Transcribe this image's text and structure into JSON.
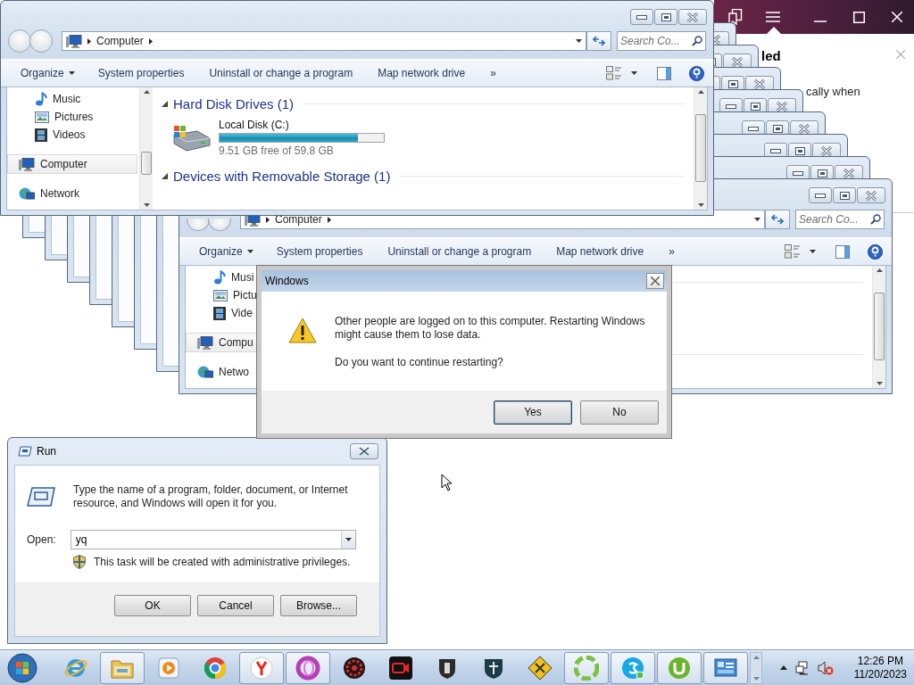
{
  "browser": {
    "heading": "led",
    "text": "cally when"
  },
  "explorer_front": {
    "address": "Computer",
    "search": {
      "placeholder": "Search Co..."
    },
    "commands": [
      {
        "label": "Organize",
        "kind": "menu"
      },
      {
        "label": "System properties",
        "kind": "plain"
      },
      {
        "label": "Uninstall or change a program",
        "kind": "plain"
      },
      {
        "label": "Map network drive",
        "kind": "plain"
      },
      {
        "label": "»",
        "kind": "more"
      }
    ],
    "nav": [
      {
        "label": "Music",
        "kind": "music",
        "selected": false
      },
      {
        "label": "Pictures",
        "kind": "pictures",
        "selected": false
      },
      {
        "label": "Videos",
        "kind": "videos",
        "selected": false
      },
      {
        "label": "Computer",
        "kind": "computer",
        "selected": true
      },
      {
        "label": "Network",
        "kind": "network",
        "selected": false
      }
    ],
    "groups": [
      {
        "title": "Hard Disk Drives (1)",
        "expanded": true,
        "items": [
          {
            "name": "Local Disk (C:)",
            "level": 0.84,
            "free": "9.51 GB free of 59.8 GB"
          }
        ]
      },
      {
        "title": "Devices with Removable Storage (1)",
        "expanded": true
      }
    ]
  },
  "explorer_back": {
    "address": "Computer",
    "search": {
      "placeholder": "Search Co..."
    },
    "commands": [
      {
        "label": "Organize",
        "kind": "menu"
      },
      {
        "label": "System properties",
        "kind": "plain"
      },
      {
        "label": "Uninstall or change a program",
        "kind": "plain"
      },
      {
        "label": "Map network drive",
        "kind": "plain"
      },
      {
        "label": "»",
        "kind": "more"
      }
    ],
    "nav": [
      {
        "label": "Musi",
        "kind": "music",
        "selected": false
      },
      {
        "label": "Pictu",
        "kind": "pictures",
        "selected": false
      },
      {
        "label": "Vide",
        "kind": "videos",
        "selected": false
      },
      {
        "label": "Compu",
        "kind": "computer",
        "selected": true
      },
      {
        "label": "Netwo",
        "kind": "network",
        "selected": false
      }
    ]
  },
  "dialog": {
    "title": "Windows",
    "message": "Other people are logged on to this computer. Restarting Windows might cause them to lose data.",
    "question": "Do you want to continue restarting?",
    "buttons": [
      {
        "label": "Yes",
        "default": true
      },
      {
        "label": "No",
        "default": false
      }
    ]
  },
  "run": {
    "title": "Run",
    "description": "Type the name of a program, folder, document, or Internet resource, and Windows will open it for you.",
    "open_label": "Open:",
    "value": "yq",
    "note": "This task will be created with administrative privileges.",
    "buttons": [
      "OK",
      "Cancel",
      "Browse..."
    ]
  },
  "taskbar": {
    "items": [
      {
        "running": false
      },
      {
        "running": true
      },
      {
        "running": false
      },
      {
        "running": false
      },
      {
        "running": true
      },
      {
        "running": true
      },
      {
        "running": false
      },
      {
        "running": false
      },
      {
        "running": false
      },
      {
        "running": false
      },
      {
        "running": false
      },
      {
        "running": true
      },
      {
        "running": true
      },
      {
        "running": true
      },
      {
        "running": true
      }
    ],
    "time": "12:26 PM",
    "date": "11/20/2023"
  }
}
